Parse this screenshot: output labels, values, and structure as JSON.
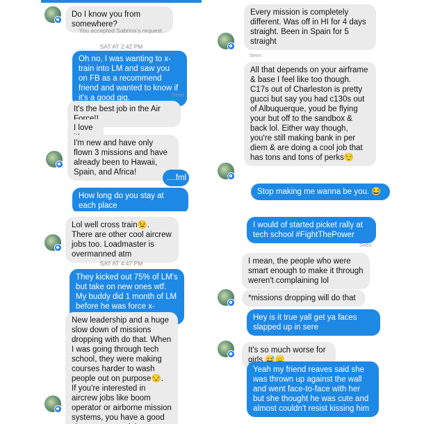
{
  "panel1": {
    "msg_know": "Do I know you from somewhere?",
    "accepted": "You accepted Sabrina's request.",
    "timestamp": "SAT AT 2:42 PM",
    "msg_xtrain": "Oh no, I was wanting to x-train into LM and saw you on FB as a recommend friend and wanted to know if it's a good gig.",
    "seen": "Seen",
    "msg_best": "It's the best job in the Air Force!!",
    "msg_love": "I love it!",
    "msg_new": "I'm new and have only flown 3 missions and have already been to Hawaii, Spain, and Africa!",
    "msg_fml": "....fml",
    "msg_stay": "How long do you stay at each place"
  },
  "panel2": {
    "msg_mission": "Every mission is completely different. Was off in HI for 4 days straight. Been in Spain for 5 straight",
    "seen": "Seen",
    "msg_airframe": "All that depends on your airframe & base I feel like too though. C17s out of Charleston is pretty gucci but say you had c130s out of Albuquerque, youd be flying your but off to the sandbox & back lol. Either way though, you're still making bank in per diem & are doing a cool job that has tons and tons of perks😌",
    "msg_stop": "Stop making me wanna be you. 😂"
  },
  "panel3": {
    "msg_lol": "Lol well cross train😉. There are other cool aircrew jobs too. Loadmaster is overmanned atm",
    "timestamp": "SAT AT 4:47 PM",
    "msg_kicked": "They kicked out 75% of LM's but take on new ones wtf. My buddy did 1 month of LM before he was force x-trained.",
    "msg_leadership": "New leadership and a huge slow down of missions dropping with do that. When I was going through tech school, they were making courses harder to wash people out on purpose😒.\nIf you're interested in aircrew jobs like boom operator or airborne mission systems, you have a good shot at cross training"
  },
  "panel4": {
    "msg_picket": "I would of started picket rally at tech school #FightThePower",
    "seen": "Seen",
    "msg_mean": "I mean, the people who were smart enough to make it through weren't complaining lol",
    "msg_dropping": "*missions dropping will do that",
    "msg_faces": "Hey is it true yall get ya faces slapped up in sere",
    "msg_worse": "It's so much worse for girls 😅😑",
    "msg_reaves": "Yeah my friend reaves said she was thrown up against the wall and went face-to-face with her but she thought he was cute and almost couldn't resist kissing him"
  },
  "colors": {
    "outgoing": "#1e88e5",
    "incoming": "#ebebeb"
  }
}
